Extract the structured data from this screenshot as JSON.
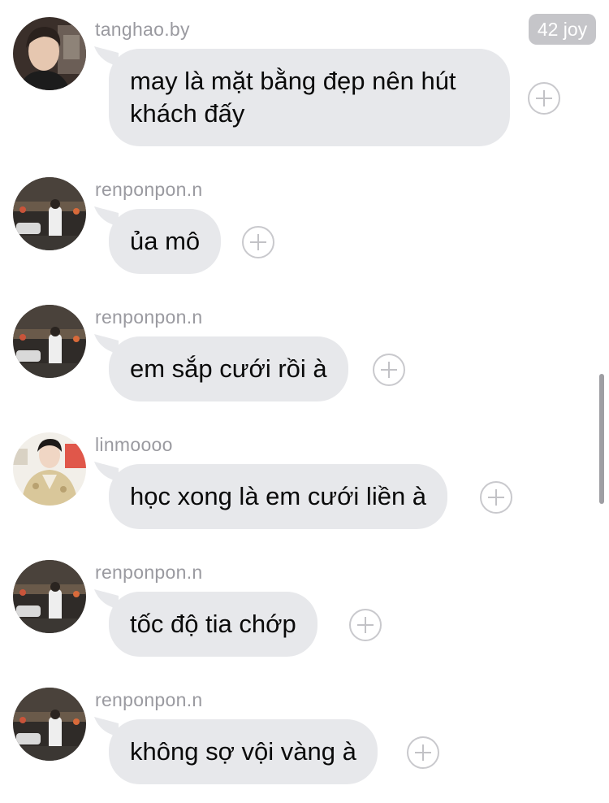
{
  "reaction_badge": {
    "label": "42 joy"
  },
  "messages": [
    {
      "username": "tanghao.by",
      "text": "may là mặt bằng đẹp nên hút khách đấy",
      "avatar": "avatar-tanghao"
    },
    {
      "username": "renponpon.n",
      "text": "ủa mô",
      "avatar": "avatar-renponpon"
    },
    {
      "username": "renponpon.n",
      "text": "em sắp cưới rồi à",
      "avatar": "avatar-renponpon"
    },
    {
      "username": "linmoooo",
      "text": "học xong là em cưới liền à",
      "avatar": "avatar-linmoooo"
    },
    {
      "username": "renponpon.n",
      "text": "tốc độ tia chớp",
      "avatar": "avatar-renponpon"
    },
    {
      "username": "renponpon.n",
      "text": "không sợ vội vàng à",
      "avatar": "avatar-renponpon"
    }
  ],
  "icons": {
    "react": "add-reaction-icon"
  },
  "colors": {
    "bubble": "#e7e8eb",
    "username": "#9a9aa0",
    "badge": "#c5c5c9",
    "text": "#0a0a0a"
  }
}
